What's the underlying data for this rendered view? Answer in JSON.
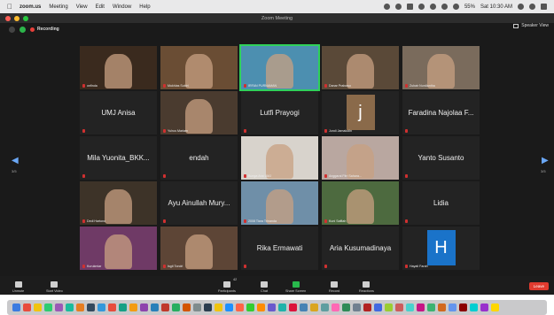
{
  "menubar": {
    "app_name": "zoom.us",
    "items": [
      "Meeting",
      "View",
      "Edit",
      "Window",
      "Help"
    ],
    "battery": "55%",
    "clock": "Sat 10:30 AM"
  },
  "window": {
    "title": "Zoom Meeting",
    "recording_label": "Recording",
    "view_label": "Speaker View"
  },
  "nav": {
    "left_page": "3/5",
    "right_page": "3/5"
  },
  "tiles": [
    {
      "name": "onfinda",
      "label": "",
      "video": true,
      "bg": "#3a2a1e"
    },
    {
      "name": "Mukhlas Subiri",
      "label": "",
      "video": true,
      "bg": "#6a4d34"
    },
    {
      "name": "IRFAN PURNAMAN",
      "label": "",
      "video": true,
      "bg": "#4c8fb0",
      "active": true
    },
    {
      "name": "Danar Prabowo",
      "label": "",
      "video": true,
      "bg": "#5a4938"
    },
    {
      "name": "Zubair Nurdiantha",
      "label": "",
      "video": true,
      "bg": "#7a6b5c"
    },
    {
      "name": "",
      "label": "UMJ Anisa",
      "video": false
    },
    {
      "name": "Yuhus Mariam",
      "label": "",
      "video": true,
      "bg": "#4a3b2f"
    },
    {
      "name": "",
      "label": "Lutfi Prayogi",
      "video": false
    },
    {
      "name": "Jundi Jamaludin",
      "label": "j",
      "video": false,
      "avatar": true
    },
    {
      "name": "",
      "label": "Faradina Najolaa F...",
      "video": false
    },
    {
      "name": "",
      "label": "Mila Yuonita_BKK...",
      "video": false
    },
    {
      "name": "",
      "label": "endah",
      "video": false
    },
    {
      "name": "Bunga Ana UMJ",
      "label": "",
      "video": true,
      "bg": "#d8d3cc"
    },
    {
      "name": "Anggarai Fitri Sahara...",
      "label": "",
      "video": true,
      "bg": "#b9a7a0"
    },
    {
      "name": "",
      "label": "Yanto Susanto",
      "video": false
    },
    {
      "name": "Dedi Hartono",
      "label": "",
      "video": true,
      "bg": "#3d3328"
    },
    {
      "name": "",
      "label": "Ayu Ainullah Mury...",
      "video": false
    },
    {
      "name": "2008 Tiara Trinanda",
      "label": "",
      "video": true,
      "bg": "#6f8fa8"
    },
    {
      "name": "Kuni Saffiah",
      "label": "",
      "video": true,
      "bg": "#4d6a3f"
    },
    {
      "name": "",
      "label": "Lidia",
      "video": false
    },
    {
      "name": "Kurukmiar",
      "label": "",
      "video": true,
      "bg": "#6f3a66"
    },
    {
      "name": "Isgit Tondri",
      "label": "",
      "video": true,
      "bg": "#5d4536"
    },
    {
      "name": "",
      "label": "Rika Ermawati",
      "video": false
    },
    {
      "name": "",
      "label": "Aria Kusumadinaya",
      "video": false
    },
    {
      "name": "Hayati Farah",
      "label": "H",
      "video": false,
      "avatar": true,
      "avatar_color": "#1a73c9"
    }
  ],
  "toolbar": {
    "unmute": "Unmute",
    "start_video": "Start Video",
    "participants": "Participants",
    "participants_count": "42",
    "chat": "Chat",
    "share_screen": "Share Screen",
    "record": "Record",
    "reactions": "Reactions",
    "leave": "Leave"
  },
  "colors": {
    "active_speaker": "#2fd15a",
    "leave": "#e03b2f",
    "share": "#28b84c",
    "recording": "#e8403a"
  }
}
